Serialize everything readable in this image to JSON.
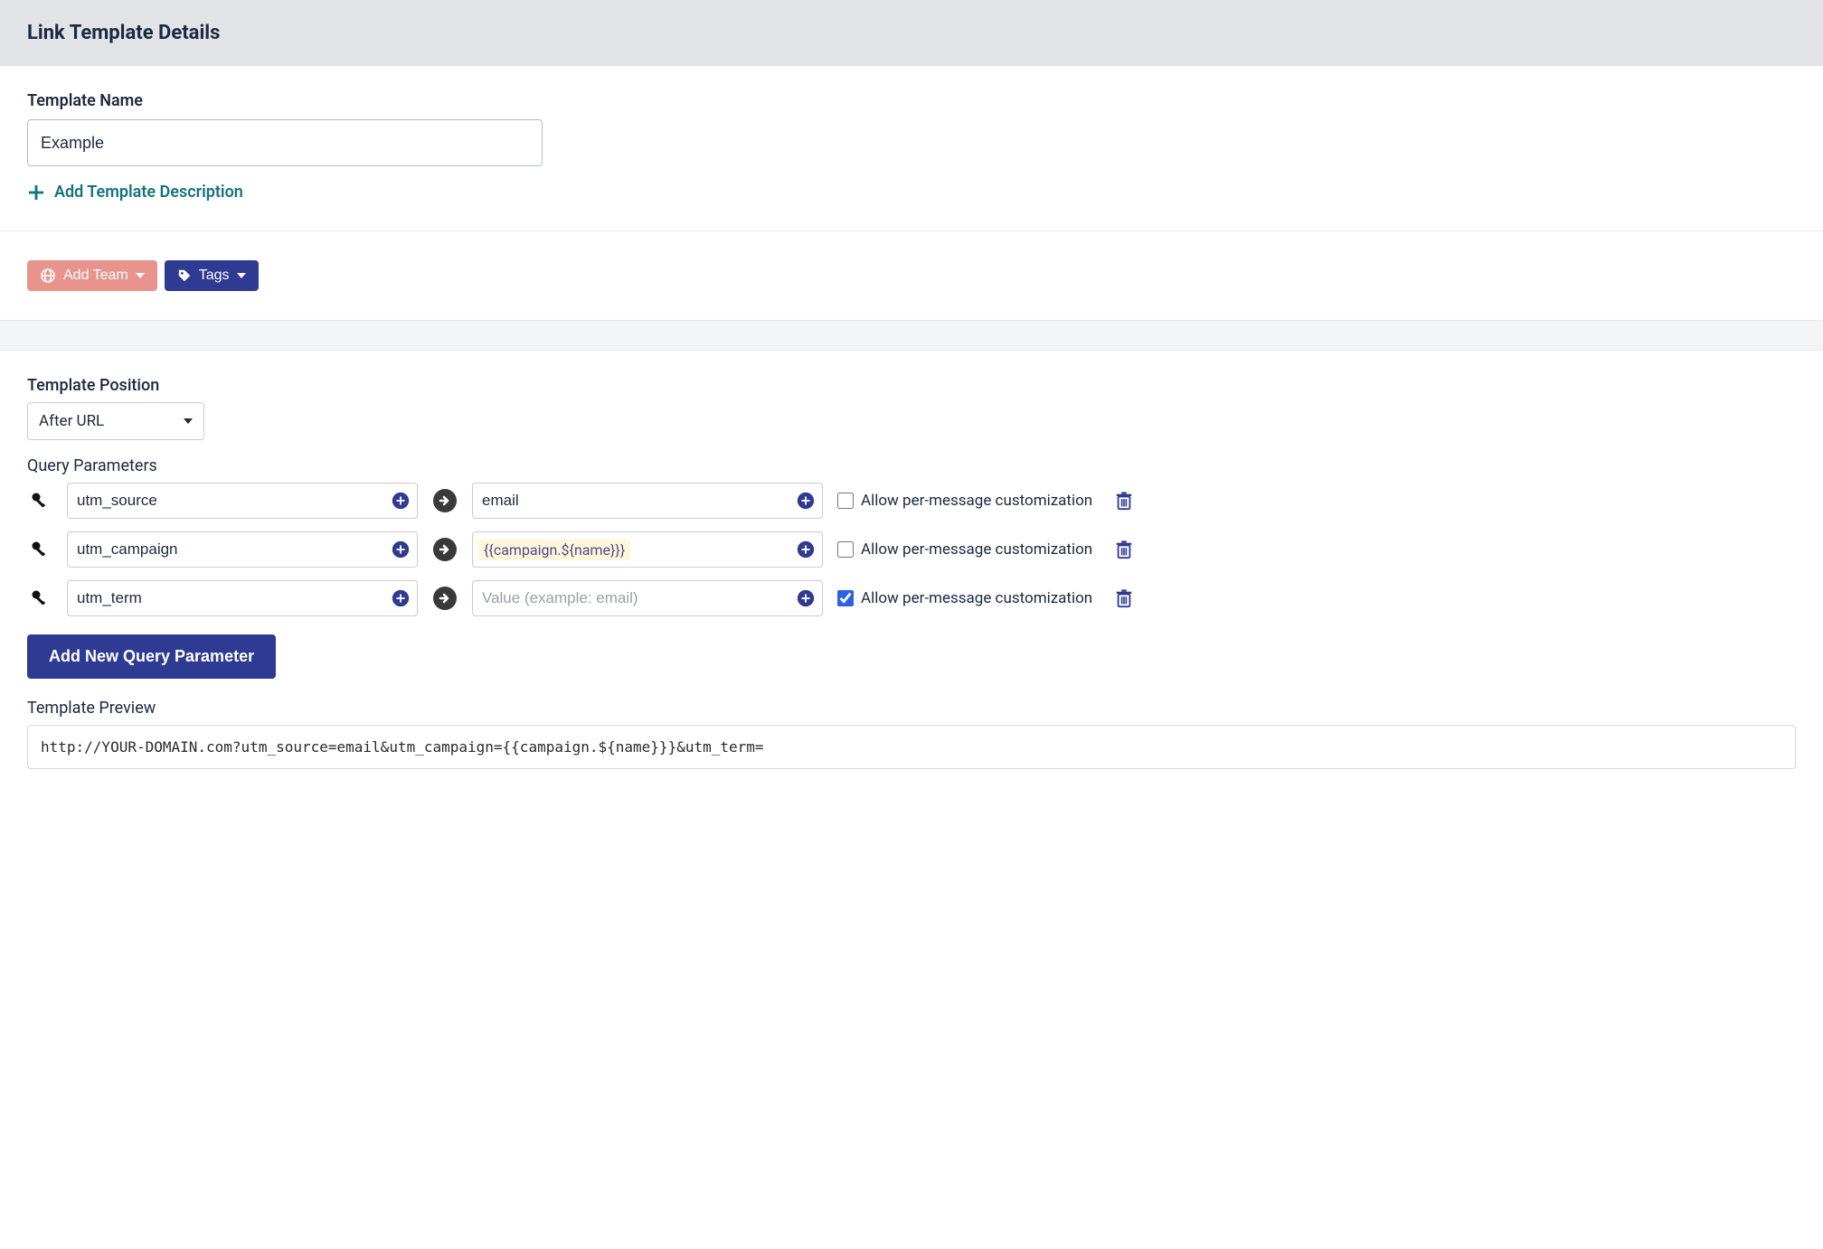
{
  "header": {
    "title": "Link Template Details"
  },
  "templateName": {
    "label": "Template Name",
    "value": "Example"
  },
  "addDescription": {
    "label": "Add Template Description"
  },
  "buttons": {
    "addTeam": "Add Team",
    "tags": "Tags",
    "addParam": "Add New Query Parameter"
  },
  "position": {
    "label": "Template Position",
    "value": "After URL"
  },
  "queryParams": {
    "label": "Query Parameters",
    "rows": [
      {
        "key": "utm_source",
        "value": "email",
        "placeholder": "",
        "token": false,
        "allow": false
      },
      {
        "key": "utm_campaign",
        "value": "{{campaign.${name}}}",
        "placeholder": "",
        "token": true,
        "allow": false
      },
      {
        "key": "utm_term",
        "value": "",
        "placeholder": "Value (example: email)",
        "token": false,
        "allow": true
      }
    ],
    "allowLabel": "Allow per-message customization"
  },
  "preview": {
    "label": "Template Preview",
    "value": "http://YOUR-DOMAIN.com?utm_source=email&utm_campaign={{campaign.${name}}}&utm_term="
  }
}
